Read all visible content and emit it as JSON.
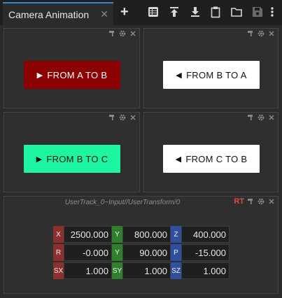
{
  "tab": {
    "title": "Camera Animation",
    "close_glyph": "✕"
  },
  "toolbar": {
    "add_glyph": "+",
    "icons": [
      "grid-view-icon",
      "upload-icon",
      "download-icon",
      "clipboard-icon",
      "folder-icon",
      "save-icon",
      "more-vertical-icon"
    ]
  },
  "buttons": [
    {
      "label": "FROM A TO B",
      "arrow": "▶",
      "bg": "#8b0000",
      "fg": "#ffffff"
    },
    {
      "label": "FROM B TO A",
      "arrow": "◀",
      "bg": "#ffffff",
      "fg": "#111111"
    },
    {
      "label": "FROM B TO C",
      "arrow": "▶",
      "bg": "#1ef5a0",
      "fg": "#111111"
    },
    {
      "label": "FROM C TO B",
      "arrow": "◀",
      "bg": "#ffffff",
      "fg": "#111111"
    }
  ],
  "transform": {
    "path": "UserTrack_0~Input//UserTransform/0",
    "rt_label": "RT",
    "rows": [
      [
        {
          "label": "X",
          "value": "2500.000"
        },
        {
          "label": "Y",
          "value": "800.000"
        },
        {
          "label": "Z",
          "value": "400.000"
        }
      ],
      [
        {
          "label": "R",
          "value": "-0.000"
        },
        {
          "label": "Y",
          "value": "90.000"
        },
        {
          "label": "P",
          "value": "-15.000"
        }
      ],
      [
        {
          "label": "SX",
          "value": "1.000"
        },
        {
          "label": "SY",
          "value": "1.000"
        },
        {
          "label": "SZ",
          "value": "1.000"
        }
      ]
    ]
  }
}
